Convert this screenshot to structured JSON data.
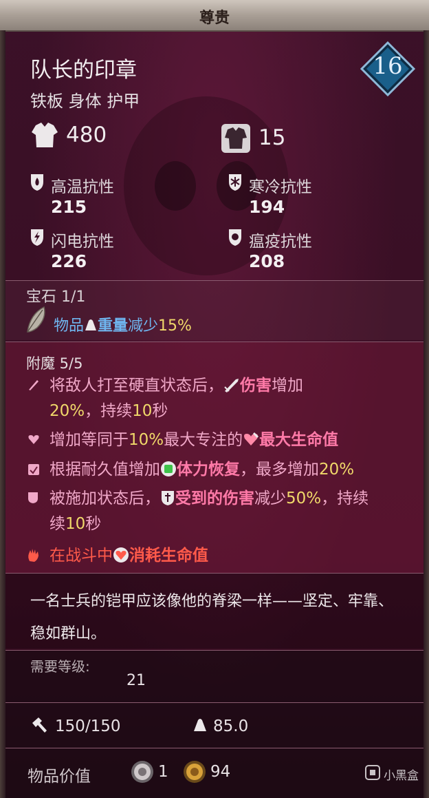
{
  "rarity": "尊贵",
  "item": {
    "name": "队长的印章",
    "type": "铁板 身体 护甲",
    "level": "16"
  },
  "stats": {
    "armor": "480",
    "weight_class": "15"
  },
  "resistances": {
    "fire_label": "高温抗性",
    "fire_value": "215",
    "cold_label": "寒冷抗性",
    "cold_value": "194",
    "lightning_label": "闪电抗性",
    "lightning_value": "226",
    "plague_label": "瘟疫抗性",
    "plague_value": "208"
  },
  "gem": {
    "title": "宝石 1/1",
    "effect_prefix": "物品",
    "effect_keyword": "重量",
    "effect_verb": "减少",
    "effect_value": "15%"
  },
  "enchantments": {
    "title": "附魔 5/5",
    "e1_a": "将敌人打至硬直状态后，",
    "e1_kw": "伤害",
    "e1_b": "增加",
    "e1_val": "20%",
    "e1_c": "，持续",
    "e1_dur": "10",
    "e1_d": "秒",
    "e2_a": "增加等同于",
    "e2_val": "10%",
    "e2_b": "最大专注的",
    "e2_kw": "最大生命值",
    "e3_a": "根据耐久值增加",
    "e3_kw": "体力恢复",
    "e3_b": "，最多增加",
    "e3_val": "20%",
    "e4_a": "被施加状态后，",
    "e4_kw1": "受到的",
    "e4_kw2": "伤害",
    "e4_b": "减少",
    "e4_val": "50%",
    "e4_c": "，持续",
    "e4_dur": "10",
    "e4_d": "秒",
    "e5_a": "在战斗中",
    "e5_kw": "消耗生命值"
  },
  "description": "一名士兵的铠甲应该像他的脊梁一样——坚定、牢靠、稳如群山。",
  "requirements": {
    "level_label": "需要等级:",
    "level_value": "21",
    "durability": "150/150",
    "weight": "85.0",
    "price_label": "物品价值",
    "silver": "1",
    "gold": "94"
  },
  "watermark": "小黑盒",
  "colors": {
    "enchant_text": "#f0a8c8",
    "keyword_pink": "#ff7aa8",
    "number_yellow": "#f0d86a",
    "gem_blue": "#6fb6f0",
    "curse_red": "#ff5a4a",
    "level_badge": "#1a5f8a"
  }
}
